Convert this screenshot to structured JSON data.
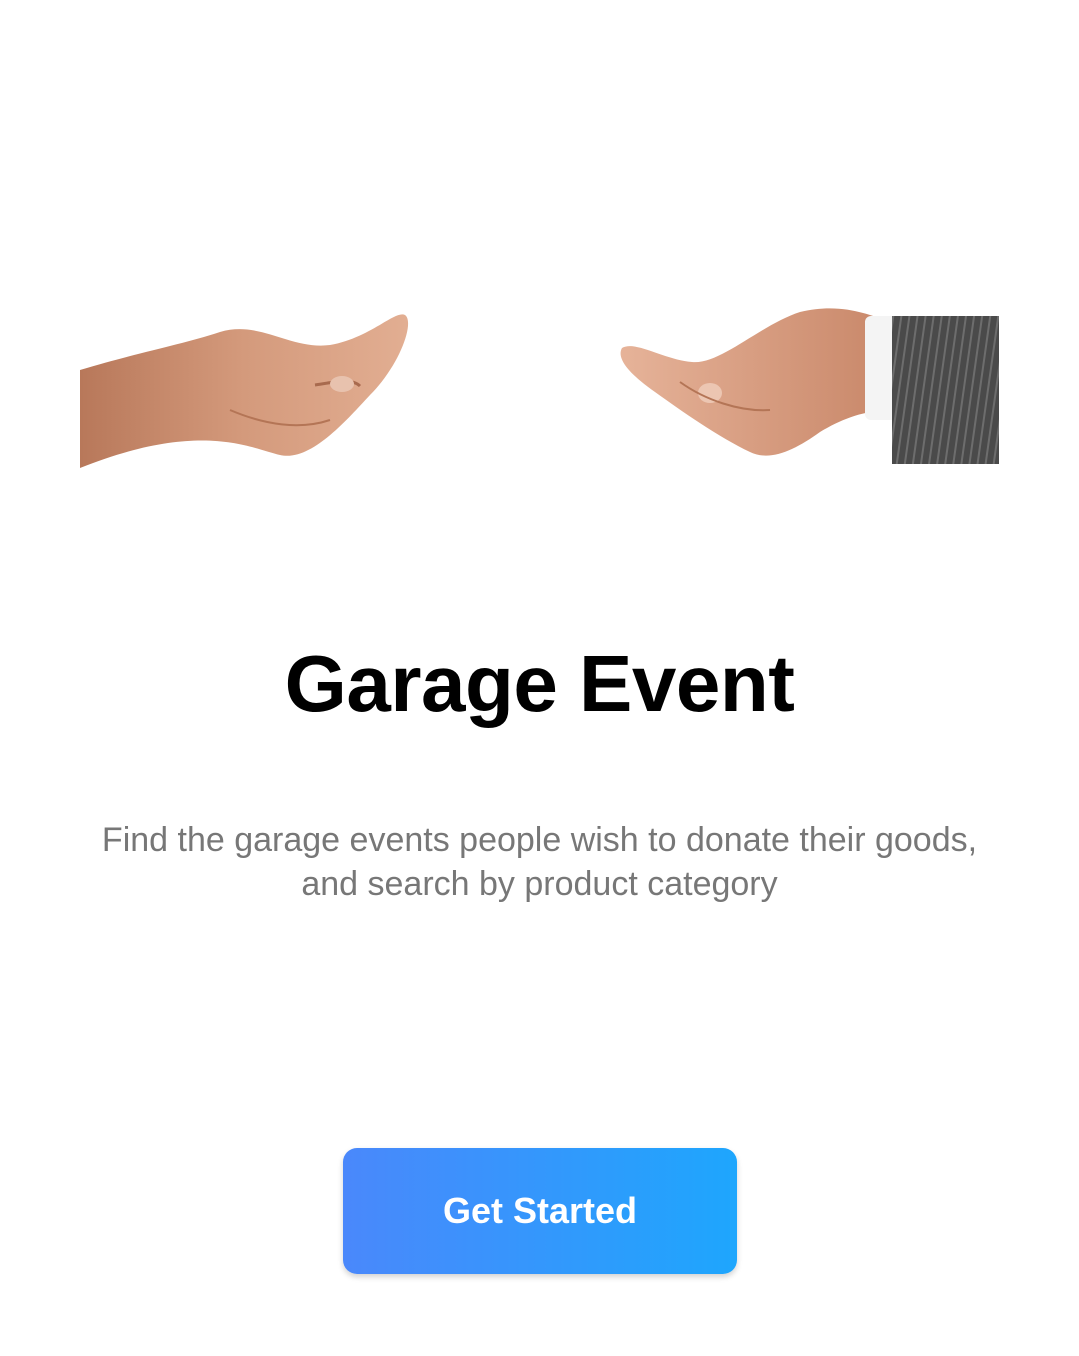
{
  "app": {
    "title": "Garage Event",
    "description_line1": "Find the garage events people wish to donate their goods,",
    "description_line2": "and search by product category"
  },
  "hero": {
    "image": "two-open-hands-illustration"
  },
  "actions": {
    "get_started_label": "Get Started"
  },
  "colors": {
    "title": "#000000",
    "description": "#777777",
    "button_gradient_start": "#4a88fb",
    "button_gradient_end": "#1ea6fd",
    "button_text": "#ffffff",
    "background": "#ffffff"
  }
}
